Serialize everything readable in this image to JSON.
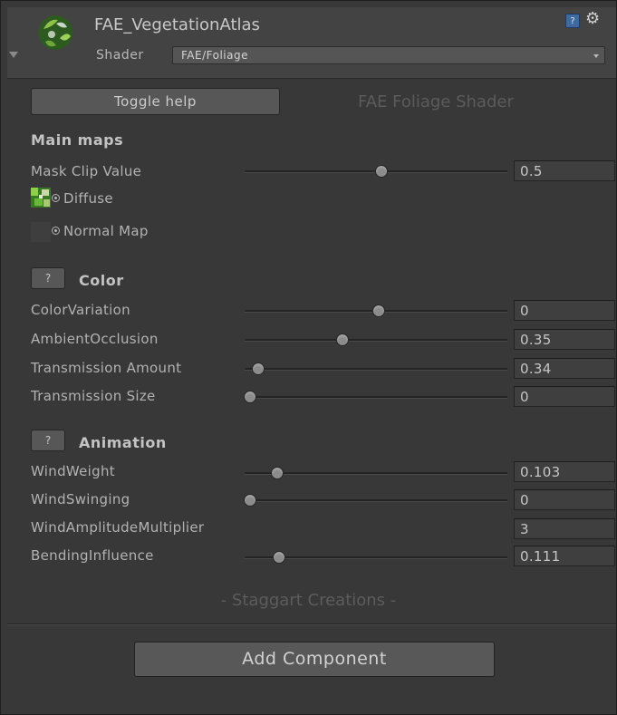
{
  "header": {
    "material_name": "FAE_VegetationAtlas",
    "shader_label": "Shader",
    "shader_value": "FAE/Foliage",
    "help_icon_text": "?"
  },
  "toolbar": {
    "toggle_help_label": "Toggle help",
    "shader_title": "FAE Foliage Shader"
  },
  "sections": {
    "main_maps": "Main maps",
    "color": "Color",
    "animation": "Animation",
    "help_button": "?"
  },
  "properties": {
    "mask_clip": {
      "label": "Mask Clip Value",
      "value": "0.5",
      "level": 0.5
    },
    "diffuse": {
      "label": "Diffuse"
    },
    "normal_map": {
      "label": "Normal Map"
    },
    "color_variation": {
      "label": "ColorVariation",
      "value": "0",
      "level": 0.49
    },
    "ambient_occlusion": {
      "label": "AmbientOcclusion",
      "value": "0.35",
      "level": 0.35
    },
    "transmission_amount": {
      "label": "Transmission Amount",
      "value": "0.34",
      "level": 0.03
    },
    "transmission_size": {
      "label": "Transmission Size",
      "value": "0",
      "level": 0.0
    },
    "wind_weight": {
      "label": "WindWeight",
      "value": "0.103",
      "level": 0.103
    },
    "wind_swinging": {
      "label": "WindSwinging",
      "value": "0",
      "level": 0.0
    },
    "wind_amplitude": {
      "label": "WindAmplitudeMultiplier",
      "value": "3"
    },
    "bending_influence": {
      "label": "BendingInfluence",
      "value": "0.111",
      "level": 0.111
    }
  },
  "footer": {
    "credit": "- Staggart Creations -",
    "add_component_label": "Add Component"
  },
  "colors": {
    "panel_bg": "#383838",
    "header_bg": "#434343",
    "help_icon_blue": "#3e6aa0"
  },
  "icons": [
    "material-sphere-icon",
    "foldout-arrow-icon",
    "help-book-icon",
    "gear-icon",
    "texture-target-icon",
    "diffuse-texture-thumbnail"
  ]
}
